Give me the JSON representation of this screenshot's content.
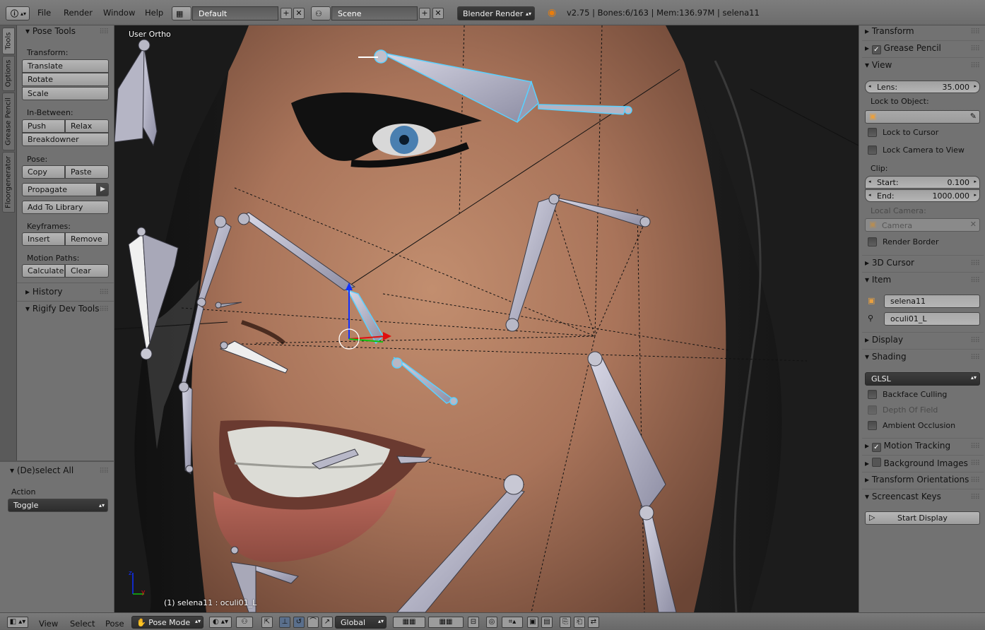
{
  "topbar": {
    "menus": [
      "File",
      "Render",
      "Window",
      "Help"
    ],
    "screen_layout": "Default",
    "scene": "Scene",
    "render_engine": "Blender Render",
    "stats": "v2.75 | Bones:6/163 | Mem:136.97M | selena11"
  },
  "left_tabs": [
    "Tools",
    "Options",
    "Grease Pencil",
    "Floorgenerator"
  ],
  "pose_tools": {
    "title": "Pose Tools",
    "transform_label": "Transform:",
    "translate": "Translate",
    "rotate": "Rotate",
    "scale": "Scale",
    "inbetween_label": "In-Between:",
    "push": "Push",
    "relax": "Relax",
    "breakdowner": "Breakdowner",
    "pose_label": "Pose:",
    "copy": "Copy",
    "paste": "Paste",
    "propagate": "Propagate",
    "add_to_library": "Add To Library",
    "keyframes_label": "Keyframes:",
    "insert": "Insert",
    "remove": "Remove",
    "motion_paths_label": "Motion Paths:",
    "calculate": "Calculate",
    "clear": "Clear"
  },
  "history": {
    "title": "History"
  },
  "rigify": {
    "title": "Rigify Dev Tools"
  },
  "operator": {
    "title": "(De)select All",
    "action_label": "Action",
    "action_value": "Toggle"
  },
  "viewport": {
    "view_name": "User Ortho",
    "active_info": "(1) selena11 : oculi01_L"
  },
  "properties": {
    "transform": "Transform",
    "grease_pencil": "Grease Pencil",
    "view": "View",
    "lens_label": "Lens:",
    "lens_value": "35.000",
    "lock_to_object": "Lock to Object:",
    "lock_to_cursor": "Lock to Cursor",
    "lock_camera_to_view": "Lock Camera to View",
    "clip_label": "Clip:",
    "clip_start_label": "Start:",
    "clip_start": "0.100",
    "clip_end_label": "End:",
    "clip_end": "1000.000",
    "local_camera_label": "Local Camera:",
    "local_camera": "Camera",
    "render_border": "Render Border",
    "cursor_3d": "3D Cursor",
    "item": "Item",
    "object_name": "selena11",
    "bone_name": "oculi01_L",
    "display": "Display",
    "shading": "Shading",
    "shading_mode": "GLSL",
    "backface_culling": "Backface Culling",
    "depth_of_field": "Depth Of Field",
    "ambient_occlusion": "Ambient Occlusion",
    "motion_tracking": "Motion Tracking",
    "background_images": "Background Images",
    "transform_orientations": "Transform Orientations",
    "screencast_keys": "Screencast Keys",
    "start_display": "Start Display"
  },
  "bottombar": {
    "menus": [
      "View",
      "Select",
      "Pose"
    ],
    "mode": "Pose Mode",
    "orientation": "Global"
  }
}
